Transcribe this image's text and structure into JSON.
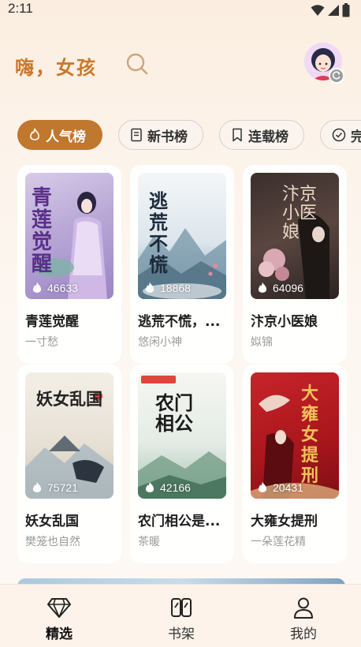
{
  "status_bar": {
    "time": "2:11"
  },
  "header": {
    "greeting": "嗨，女孩"
  },
  "tabs": [
    {
      "label": "人气榜",
      "icon": "flame-icon",
      "active": true
    },
    {
      "label": "新书榜",
      "icon": "book-icon",
      "active": false
    },
    {
      "label": "连载榜",
      "icon": "bookmark-icon",
      "active": false
    },
    {
      "label": "完",
      "icon": "check-circle-icon",
      "active": false
    }
  ],
  "books": [
    {
      "title": "青莲觉醒",
      "author": "一寸愁",
      "heat": "46633",
      "cover_text": "青莲觉醒"
    },
    {
      "title": "逃荒不慌，...",
      "author": "悠闲小神",
      "heat": "18868",
      "cover_text": "逃荒不慌"
    },
    {
      "title": "汴京小医娘",
      "author": "姒锦",
      "heat": "64096",
      "cover_text": "汴京小医娘"
    },
    {
      "title": "妖女乱国",
      "author": "樊笼也自然",
      "heat": "75721",
      "cover_text": "妖女乱国"
    },
    {
      "title": "农门相公是...",
      "author": "茶暖",
      "heat": "42166",
      "cover_text": "农门相公"
    },
    {
      "title": "大雍女提刑",
      "author": "一朵莲花精",
      "heat": "20431",
      "cover_text": "大雍女提刑"
    }
  ],
  "bottom_nav": [
    {
      "label": "精选",
      "icon": "diamond-icon",
      "active": true
    },
    {
      "label": "书架",
      "icon": "bookshelf-icon",
      "active": false
    },
    {
      "label": "我的",
      "icon": "person-icon",
      "active": false
    }
  ],
  "colors": {
    "accent": "#c0772e",
    "greeting": "#c9782b"
  }
}
